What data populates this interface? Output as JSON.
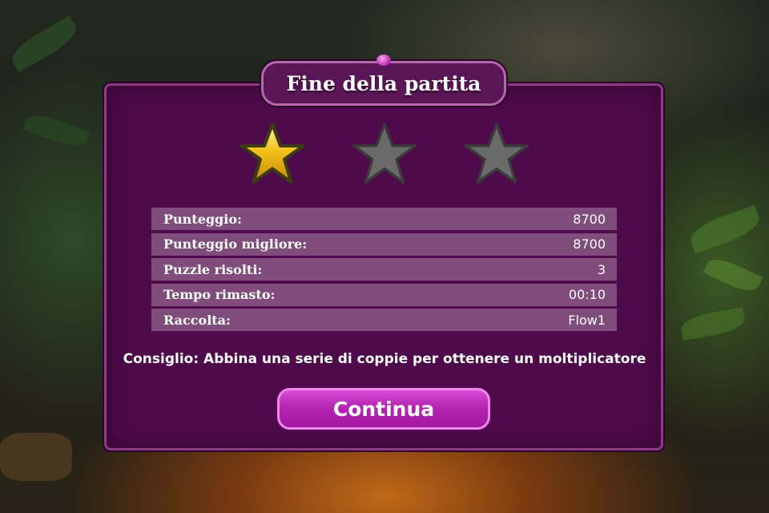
{
  "dialog": {
    "title": "Fine della partita",
    "stars_earned": 1,
    "stars_total": 3
  },
  "stats": [
    {
      "label": "Punteggio:",
      "value": "8700"
    },
    {
      "label": "Punteggio migliore:",
      "value": "8700"
    },
    {
      "label": "Puzzle risolti:",
      "value": "3"
    },
    {
      "label": "Tempo rimasto:",
      "value": "00:10"
    },
    {
      "label": "Raccolta:",
      "value": "Flow1"
    }
  ],
  "tip": "Consiglio: Abbina una serie di coppie per ottenere un moltiplicatore",
  "continue_label": "Continua",
  "colors": {
    "panel": "#4e0a4a",
    "row": "#7f4c7b",
    "button": "#b526b3",
    "star_gold": "#f2c21c",
    "star_empty": "#6a6a6a"
  }
}
